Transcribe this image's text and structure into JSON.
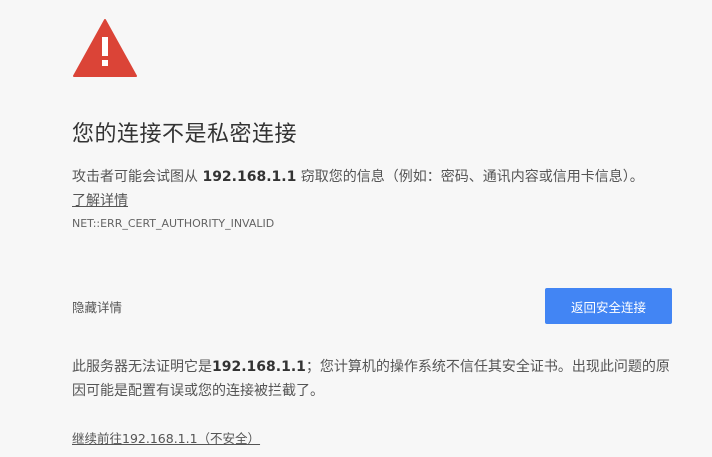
{
  "icon": {
    "name": "warning-triangle-icon",
    "color": "#db4437",
    "mark_color": "#ffffff"
  },
  "heading": "您的连接不是私密连接",
  "explanation": {
    "prefix": "攻击者可能会试图从 ",
    "host": "192.168.1.1",
    "suffix": " 窃取您的信息（例如：密码、通讯内容或信用卡信息）。"
  },
  "learn_more": "了解详情",
  "error_code": "NET::ERR_CERT_AUTHORITY_INVALID",
  "details_toggle": "隐藏详情",
  "primary_button": "返回安全连接",
  "details": {
    "prefix": "此服务器无法证明它是",
    "host": "192.168.1.1",
    "suffix": "；您计算机的操作系统不信任其安全证书。出现此问题的原因可能是配置有误或您的连接被拦截了。"
  },
  "proceed_link": "继续前往192.168.1.1（不安全）",
  "colors": {
    "background": "#f7f7f7",
    "primary_button": "#4285f4",
    "warning": "#db4437",
    "text": "#555555",
    "heading": "#333333"
  }
}
